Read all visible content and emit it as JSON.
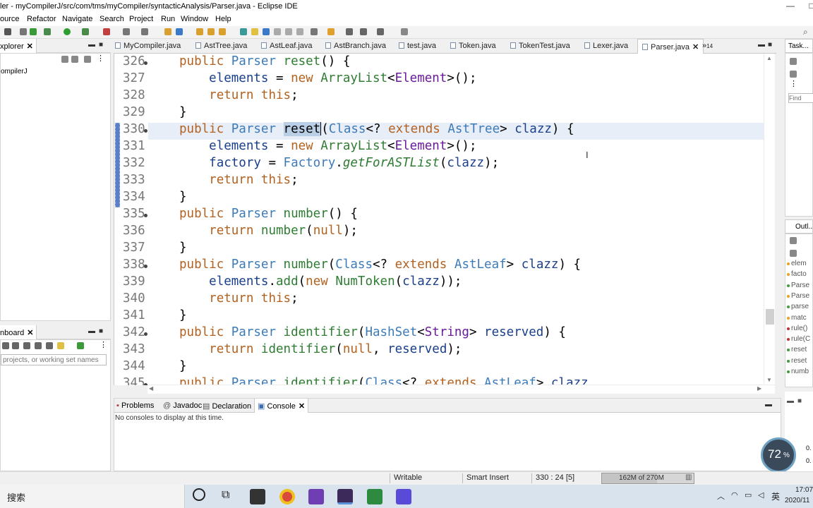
{
  "window": {
    "title": "ler - myCompilerJ/src/com/tms/myCompiler/syntacticAnalysis/Parser.java - Eclipse IDE",
    "controls": [
      "—",
      "□",
      "✕"
    ]
  },
  "menu": [
    "ource",
    "Refactor",
    "Navigate",
    "Search",
    "Project",
    "Run",
    "Window",
    "Help"
  ],
  "left_panel": {
    "explorer_tab": "xplorer",
    "project": "ompilerJ",
    "dashboard_tab": "nboard",
    "filter_placeholder": "projects, or working set names"
  },
  "editor_tabs": [
    "MyCompiler.java",
    "AstTree.java",
    "AstLeaf.java",
    "AstBranch.java",
    "test.java",
    "Token.java",
    "TokenTest.java",
    "Lexer.java",
    "Parser.java"
  ],
  "editor_active_tab": "Parser.java",
  "editor_overflow": "»",
  "editor_overflow_count": "14",
  "code_lines": [
    {
      "n": "326",
      "fold": true
    },
    {
      "n": "327",
      "fold": false
    },
    {
      "n": "328",
      "fold": false
    },
    {
      "n": "329",
      "fold": false
    },
    {
      "n": "330",
      "fold": true
    },
    {
      "n": "331",
      "fold": false
    },
    {
      "n": "332",
      "fold": false
    },
    {
      "n": "333",
      "fold": false
    },
    {
      "n": "334",
      "fold": false
    },
    {
      "n": "335",
      "fold": true
    },
    {
      "n": "336",
      "fold": false
    },
    {
      "n": "337",
      "fold": false
    },
    {
      "n": "338",
      "fold": true
    },
    {
      "n": "339",
      "fold": false
    },
    {
      "n": "340",
      "fold": false
    },
    {
      "n": "341",
      "fold": false
    },
    {
      "n": "342",
      "fold": true
    },
    {
      "n": "343",
      "fold": false
    },
    {
      "n": "344",
      "fold": false
    },
    {
      "n": "345",
      "fold": true
    }
  ],
  "right_panel": {
    "task_tab": "Task...",
    "find_placeholder": "Find",
    "outline_tab": "Outl...",
    "outline_items": [
      {
        "label": "elem",
        "color": "#f0a020"
      },
      {
        "label": "facto",
        "color": "#f0a020"
      },
      {
        "label": "Parse",
        "color": "#3aa03a"
      },
      {
        "label": "Parse",
        "color": "#f0a020"
      },
      {
        "label": "parse",
        "color": "#3aa03a"
      },
      {
        "label": "matc",
        "color": "#f0a020"
      },
      {
        "label": "rule()",
        "color": "#c03030"
      },
      {
        "label": "rule(C",
        "color": "#c03030"
      },
      {
        "label": "reset",
        "color": "#3aa03a"
      },
      {
        "label": "reset",
        "color": "#3aa03a"
      },
      {
        "label": "numb",
        "color": "#3aa03a"
      }
    ]
  },
  "console": {
    "tabs": [
      "Problems",
      "Javadoc",
      "Declaration",
      "Console"
    ],
    "active_tab": "Console",
    "message": "No consoles to display at this time."
  },
  "status": {
    "writable": "Writable",
    "insert_mode": "Smart Insert",
    "position": "330 : 24 [5]",
    "heap": "162M of 270M",
    "heap_used_fraction": 0.6
  },
  "perf_widget": {
    "value": "72",
    "unit": "%",
    "line1": "0.",
    "line2": "0."
  },
  "taskbar": {
    "search_label": "搜索",
    "ime": "英",
    "time": "17:07",
    "date": "2020/11"
  }
}
